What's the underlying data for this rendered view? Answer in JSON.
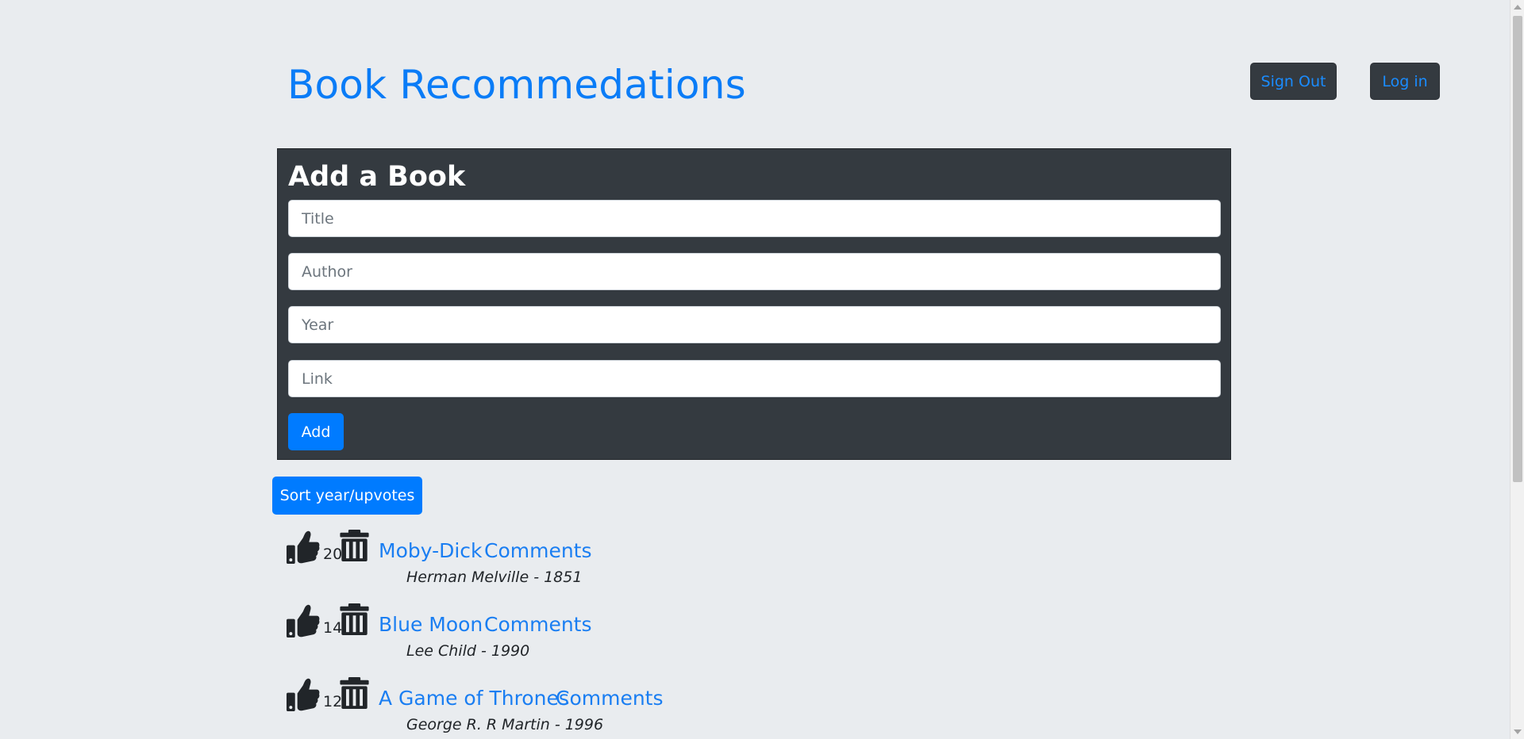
{
  "header": {
    "title": "Book Recommedations",
    "signout_label": "Sign Out",
    "login_label": "Log in"
  },
  "add_form": {
    "heading": "Add a Book",
    "title_placeholder": "Title",
    "author_placeholder": "Author",
    "year_placeholder": "Year",
    "link_placeholder": "Link",
    "add_label": "Add"
  },
  "sort_label": "Sort year/upvotes",
  "books": [
    {
      "title": "Moby-Dick",
      "comments_label": "Comments",
      "upvotes": "20",
      "meta": "Herman Melville - 1851"
    },
    {
      "title": "Blue Moon",
      "comments_label": "Comments",
      "upvotes": "14",
      "meta": "Lee Child - 1990"
    },
    {
      "title": "A Game of Thrones",
      "comments_label": "Comments",
      "upvotes": "12",
      "meta": "George R. R Martin - 1996"
    }
  ],
  "icons": {
    "like": "thumbs-up-icon",
    "delete": "trash-icon"
  },
  "colors": {
    "accent": "#007bff",
    "panel": "#343a40",
    "background": "#e9ecef"
  }
}
